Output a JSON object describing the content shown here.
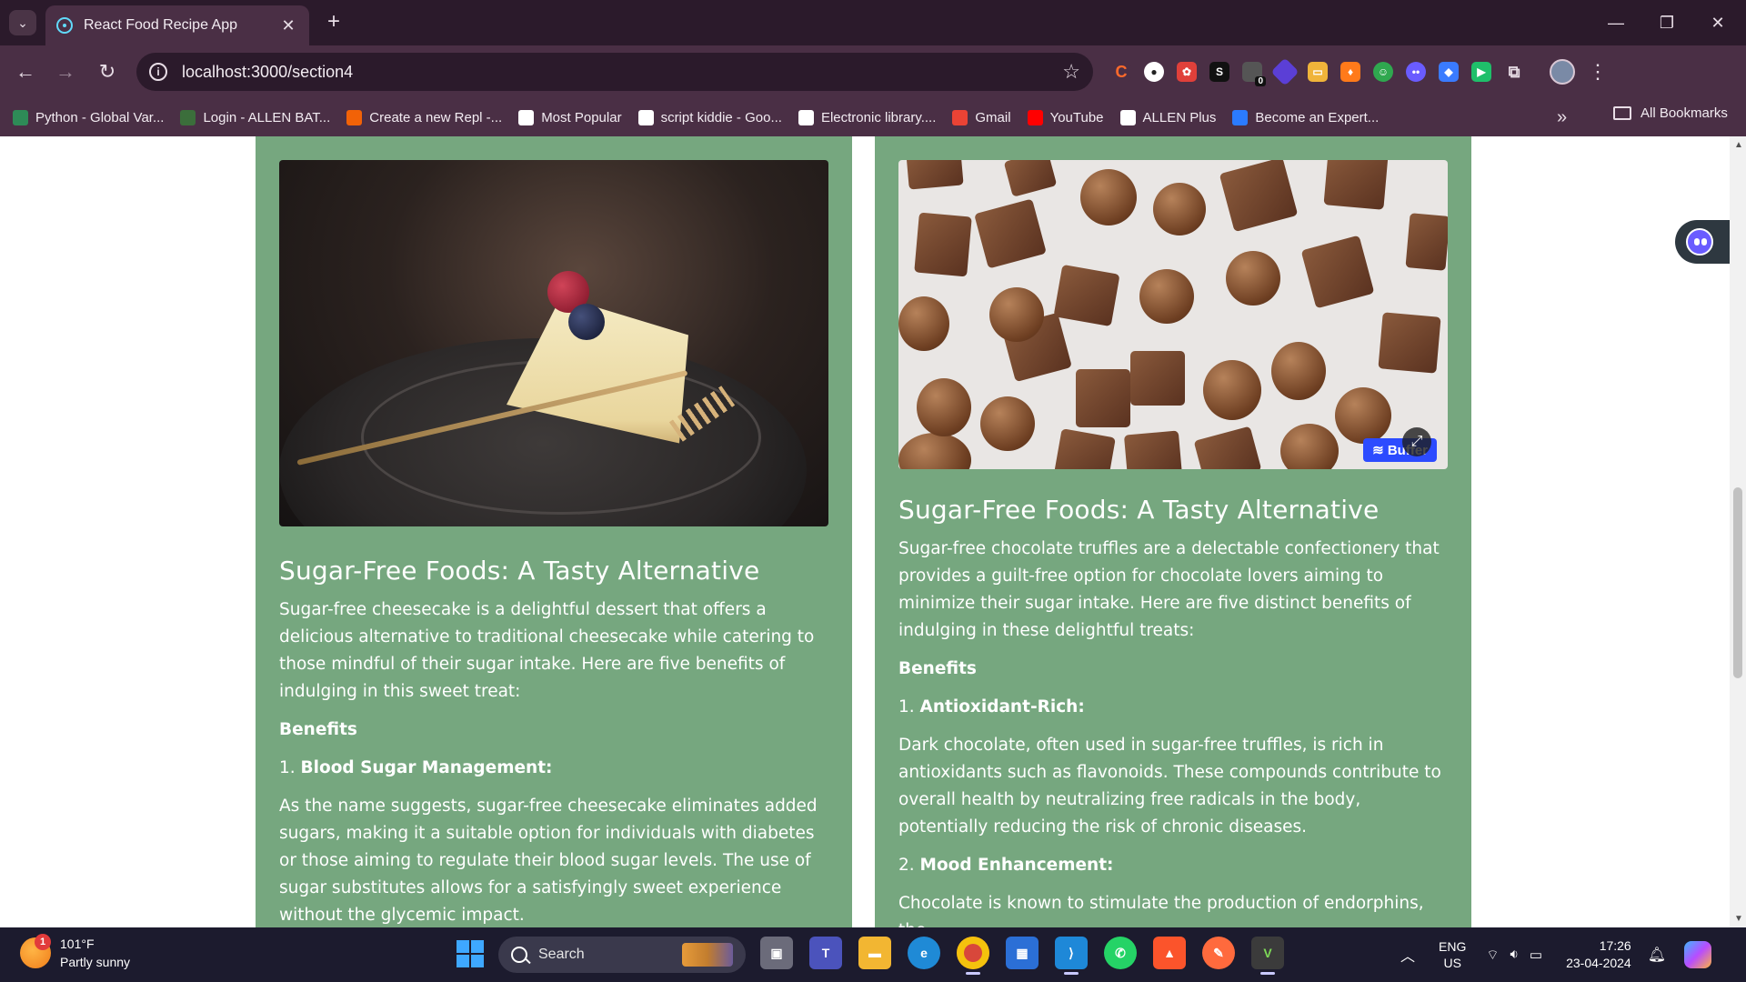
{
  "browser": {
    "tab_title": "React Food Recipe App",
    "url": "localhost:3000/section4",
    "bookmarks": [
      {
        "label": "Python - Global Var...",
        "icon": "w-icon",
        "color": "#2e8b57"
      },
      {
        "label": "Login - ALLEN BAT...",
        "icon": "allen-icon",
        "color": "#3b6e3b"
      },
      {
        "label": "Create a new Repl -...",
        "icon": "replit-icon",
        "color": "#f26207"
      },
      {
        "label": "Most Popular",
        "icon": "y-icon",
        "color": "#ffffff"
      },
      {
        "label": "script kiddie - Goo...",
        "icon": "google-icon",
        "color": "#ffffff"
      },
      {
        "label": "Electronic library....",
        "icon": "y-icon",
        "color": "#ffffff"
      },
      {
        "label": "Gmail",
        "icon": "gmail-icon",
        "color": "#ea4335"
      },
      {
        "label": "YouTube",
        "icon": "youtube-icon",
        "color": "#ff0000"
      },
      {
        "label": "ALLEN Plus",
        "icon": "allen-plus-icon",
        "color": "#ffffff"
      },
      {
        "label": "Become an Expert...",
        "icon": "expert-icon",
        "color": "#2b7bff"
      }
    ],
    "all_bookmarks_label": "All Bookmarks",
    "extension_badge": "0"
  },
  "cards": [
    {
      "image_alt": "Sugar-free cheesecake slice with berries",
      "title": "Sugar-Free Foods: A Tasty Alternative",
      "intro": "Sugar-free cheesecake is a delightful dessert that offers a delicious alternative to traditional cheesecake while catering to those mindful of their sugar intake. Here are five benefits of indulging in this sweet treat:",
      "benefits_heading": "Benefits",
      "benefits": [
        {
          "num": "1.",
          "title": "Blood Sugar Management:",
          "text": "As the name suggests, sugar-free cheesecake eliminates added sugars, making it a suitable option for individuals with diabetes or those aiming to regulate their blood sugar levels. The use of sugar substitutes allows for a satisfyingly sweet experience without the glycemic impact."
        }
      ]
    },
    {
      "image_alt": "Assorted sugar-free chocolate truffles",
      "buffer_label": "Buffer",
      "title": "Sugar-Free Foods: A Tasty Alternative",
      "intro": "Sugar-free chocolate truffles are a delectable confectionery that provides a guilt-free option for chocolate lovers aiming to minimize their sugar intake. Here are five distinct benefits of indulging in these delightful treats:",
      "benefits_heading": "Benefits",
      "benefits": [
        {
          "num": "1.",
          "title": "Antioxidant-Rich:",
          "text": "Dark chocolate, often used in sugar-free truffles, is rich in antioxidants such as flavonoids. These compounds contribute to overall health by neutralizing free radicals in the body, potentially reducing the risk of chronic diseases."
        },
        {
          "num": "2.",
          "title": "Mood Enhancement:",
          "text": "Chocolate is known to stimulate the production of endorphins, the"
        }
      ]
    }
  ],
  "taskbar": {
    "temperature": "101°F",
    "weather": "Partly sunny",
    "weather_badge": "1",
    "search_placeholder": "Search",
    "lang_top": "ENG",
    "lang_bottom": "US",
    "time": "17:26",
    "date": "23-04-2024"
  },
  "colors": {
    "card_bg": "#76a77f",
    "chrome_bg": "#4a2f45",
    "tabstrip_bg": "#2b1a2b"
  }
}
